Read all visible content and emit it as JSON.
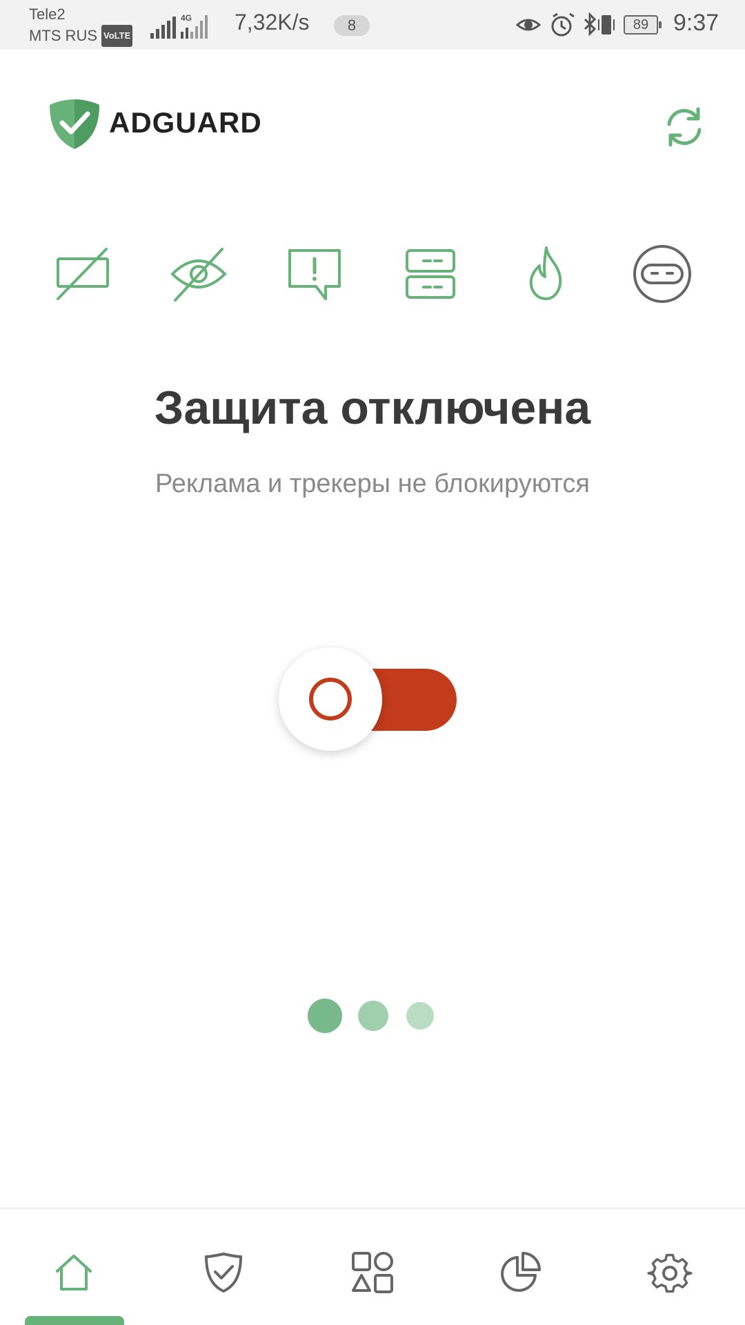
{
  "status_bar": {
    "carrier_1": "Tele2",
    "carrier_2": "MTS RUS",
    "volte_badge": "VoLTE",
    "network_type": "4G",
    "net_speed": "7,32K/s",
    "notification_count": "8",
    "battery_level": "89",
    "time": "9:37",
    "icons": [
      "signal-icon",
      "signal-4g-icon",
      "eye-icon",
      "alarm-icon",
      "bluetooth-icon",
      "vibrate-icon",
      "battery-icon"
    ]
  },
  "header": {
    "brand": "ADGUARD",
    "logo_icon": "shield-check-icon",
    "refresh_icon": "refresh-icon"
  },
  "features": [
    {
      "icon": "ad-blocking-icon",
      "state": "off"
    },
    {
      "icon": "tracking-protection-icon",
      "state": "off"
    },
    {
      "icon": "annoyances-icon",
      "state": "off"
    },
    {
      "icon": "dns-protection-icon",
      "state": "off"
    },
    {
      "icon": "firewall-icon",
      "state": "off"
    },
    {
      "icon": "stealth-mode-icon",
      "state": "off"
    }
  ],
  "protection": {
    "title": "Защита отключена",
    "subtitle": "Реклама и трекеры не блокируются",
    "toggle_state": "off"
  },
  "pager": {
    "pages": 3,
    "current": 1
  },
  "bottom_nav": {
    "items": [
      {
        "icon": "home-icon",
        "active": true
      },
      {
        "icon": "shield-check-icon",
        "active": false
      },
      {
        "icon": "apps-icon",
        "active": false
      },
      {
        "icon": "statistics-icon",
        "active": false
      },
      {
        "icon": "settings-gear-icon",
        "active": false
      }
    ]
  },
  "colors": {
    "accent_green": "#67b279",
    "toggle_off_red": "#c23b1b",
    "title_text": "#3a3a3a",
    "subtitle_text": "#8a8a8a",
    "icon_gray": "#666666"
  }
}
